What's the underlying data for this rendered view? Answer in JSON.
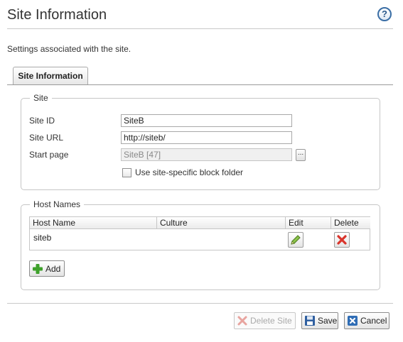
{
  "page": {
    "title": "Site Information",
    "help_icon_glyph": "?",
    "description": "Settings associated with the site."
  },
  "tabs": [
    {
      "label": "Site Information",
      "active": true
    }
  ],
  "site_section": {
    "legend": "Site",
    "site_id": {
      "label": "Site ID",
      "value": "SiteB"
    },
    "site_url": {
      "label": "Site URL",
      "value": "http://siteb/"
    },
    "start_page": {
      "label": "Start page",
      "value": "SiteB [47]",
      "browse_label": "..."
    },
    "block_folder": {
      "label": "Use site-specific block folder",
      "checked": false
    }
  },
  "host_section": {
    "legend": "Host Names",
    "columns": [
      "Host Name",
      "Culture",
      "Edit",
      "Delete"
    ],
    "rows": [
      {
        "host_name": "siteb",
        "culture": ""
      }
    ],
    "add_label": "Add"
  },
  "footer": {
    "delete_label": "Delete Site",
    "save_label": "Save",
    "cancel_label": "Cancel"
  },
  "icons": {
    "help": "help-icon",
    "edit": "pencil-icon",
    "delete": "red-x-icon",
    "add": "green-plus-icon",
    "save": "floppy-disk-icon",
    "cancel": "cancel-icon"
  },
  "colors": {
    "accent_blue": "#3a6ea5",
    "delete_red": "#d9342b",
    "add_green": "#3ea12b",
    "border_gray": "#c6c6c6"
  }
}
